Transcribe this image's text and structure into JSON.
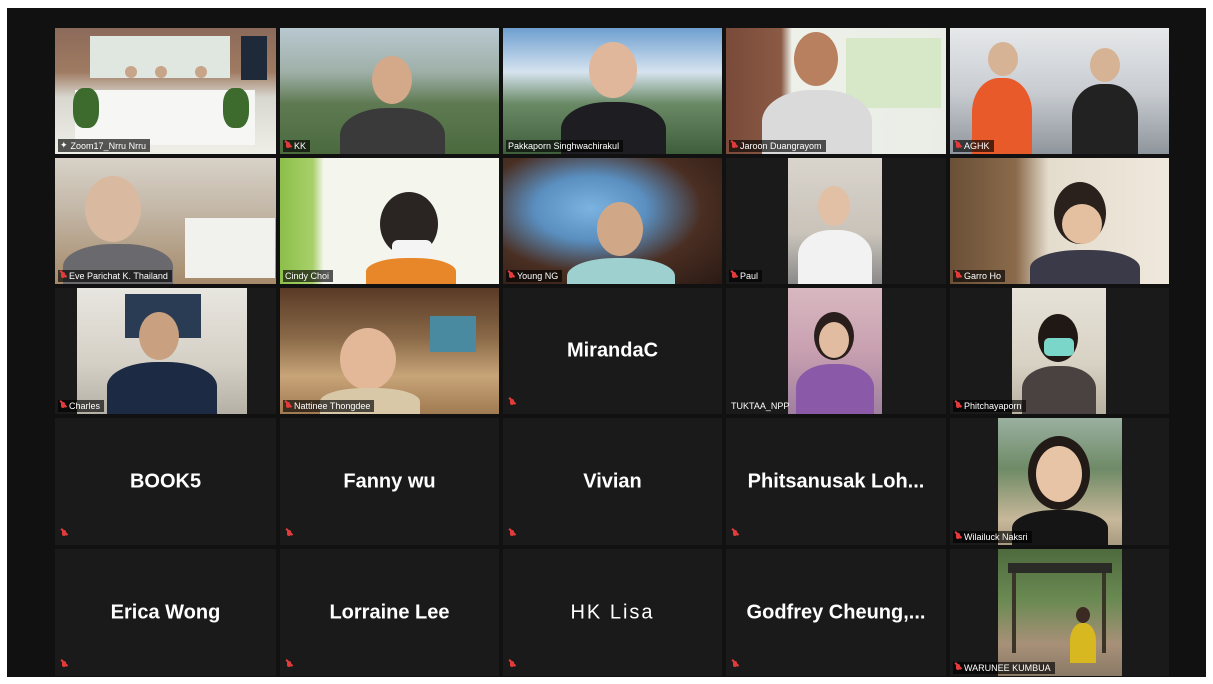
{
  "colors": {
    "background": "#111111",
    "tile": "#1a1a1a",
    "active_border": "#e4e15a",
    "muted_mic": "#e23b3b",
    "name_text": "#ffffff"
  },
  "participants": [
    {
      "name": "Zoom17_Nrru Nrru",
      "video": true,
      "pinned": true,
      "active": true
    },
    {
      "name": "KK",
      "video": true
    },
    {
      "name": "Pakkaporn Singhwachirakul",
      "video": true
    },
    {
      "name": "Jaroon Duangrayom",
      "video": true
    },
    {
      "name": "AGHK",
      "video": true
    },
    {
      "name": "Eve Parichat K. Thailand",
      "video": true
    },
    {
      "name": "Cindy Choi",
      "video": true
    },
    {
      "name": "Young NG",
      "video": true
    },
    {
      "name": "Paul",
      "video": true
    },
    {
      "name": "Garro Ho",
      "video": true
    },
    {
      "name": "Charles",
      "video": true
    },
    {
      "name": "Nattinee Thongdee",
      "video": true
    },
    {
      "name": "MirandaC",
      "video": false
    },
    {
      "name": "TUKTAA_NPP",
      "video": true
    },
    {
      "name": "Phitchayaporn",
      "video": true
    },
    {
      "name": "BOOK5",
      "video": false
    },
    {
      "name": "Fanny wu",
      "video": false
    },
    {
      "name": "Vivian",
      "video": false
    },
    {
      "name": "Phitsanusak  Loh...",
      "video": false
    },
    {
      "name": "Wilailuck Naksri",
      "video": true
    },
    {
      "name": "Erica Wong",
      "video": false
    },
    {
      "name": "Lorraine Lee",
      "video": false
    },
    {
      "name": "HK  Lisa",
      "video": false
    },
    {
      "name": "Godfrey  Cheung,...",
      "video": false
    },
    {
      "name": "WARUNEE KUMBUA",
      "video": true
    }
  ]
}
